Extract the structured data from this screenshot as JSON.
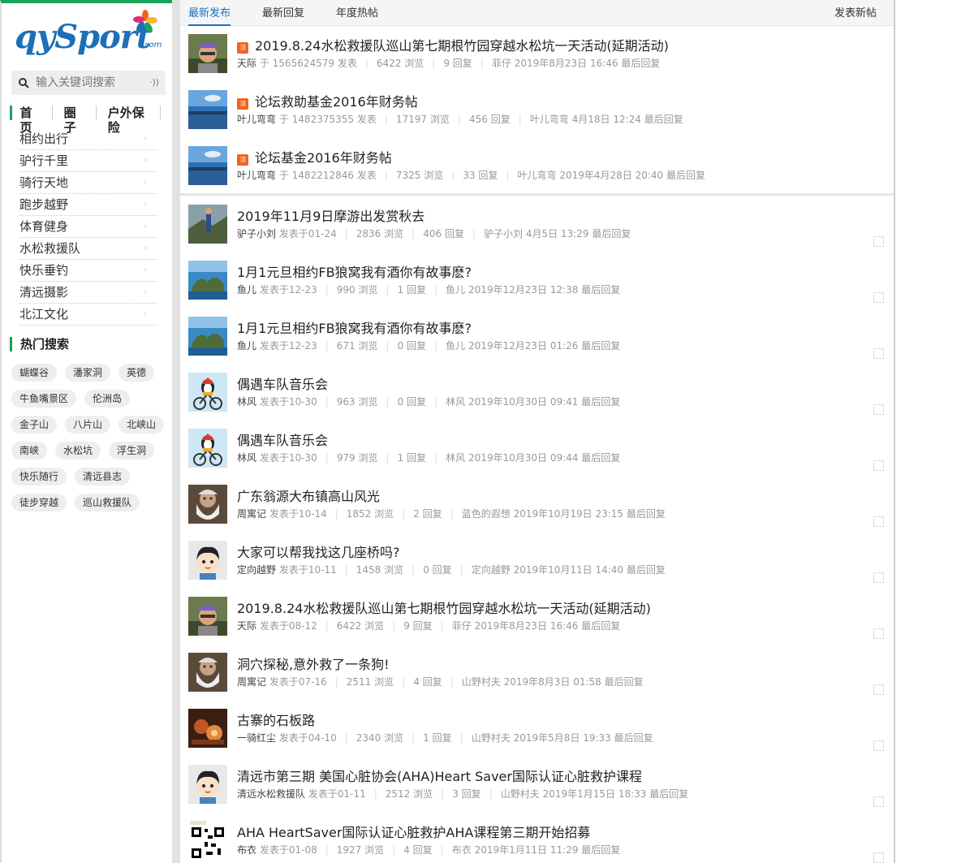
{
  "logo": {
    "text": "qySport",
    "suffix": "com"
  },
  "search": {
    "placeholder": "输入关键词搜索"
  },
  "nav_top": [
    "首页",
    "圈子",
    "户外保险"
  ],
  "forums": [
    "相约出行",
    "驴行千里",
    "骑行天地",
    "跑步越野",
    "体育健身",
    "水松救援队",
    "快乐垂钓",
    "清远摄影",
    "北江文化"
  ],
  "hot_title": "热门搜索",
  "tags": [
    [
      "蝴蝶谷",
      "潘家洞",
      "英德"
    ],
    [
      "牛鱼嘴景区",
      "伦洲岛"
    ],
    [
      "金子山",
      "八片山",
      "北峡山"
    ],
    [
      "南峡",
      "水松坑",
      "浮生洞"
    ],
    [
      "快乐随行",
      "清远县志"
    ],
    [
      "徒步穿越",
      "巡山救援队"
    ]
  ],
  "tabs": {
    "t1": "最新发布",
    "t2": "最新回复",
    "t3": "年度热帖",
    "new_post": "发表新帖"
  },
  "colors": {
    "accent_green": "#1aa35b",
    "accent_blue": "#1a6fc0",
    "badge_orange": "#f2641e"
  },
  "pinned": [
    {
      "title": "2019.8.24水松救援队巡山第七期根竹园穿越水松坑一天活动(延期活动)",
      "author": "天际",
      "posted": "于  1565624579  发表",
      "views": "6422",
      "replies": "9",
      "last_user": "菲仔",
      "last_time": "2019年8月23日  16:46",
      "avatar": "hat"
    },
    {
      "title": "论坛救助基金2016年财务帖",
      "author": "叶儿弯弯",
      "posted": "于  1482375355  发表",
      "views": "17197",
      "replies": "456",
      "last_user": "叶儿弯弯",
      "last_time": "4月18日  12:24",
      "avatar": "lake"
    },
    {
      "title": "论坛基金2016年财务帖",
      "author": "叶儿弯弯",
      "posted": "于  1482212846  发表",
      "views": "7325",
      "replies": "33",
      "last_user": "叶儿弯弯",
      "last_time": "2019年4月28日  20:40",
      "avatar": "lake"
    }
  ],
  "threads": [
    {
      "title": "2019年11月9日摩游出发赏秋去",
      "author": "驴子小刘",
      "posted": "发表于01-24",
      "views": "2836",
      "replies": "406",
      "last_user": "驴子小刘",
      "last_time": "4月5日  13:29",
      "avatar": "hiker"
    },
    {
      "title": "1月1元旦相约FB狼窝我有酒你有故事麽?",
      "author": "鱼儿",
      "posted": "发表于12-23",
      "views": "990",
      "replies": "1",
      "last_user": "鱼儿",
      "last_time": "2019年12月23日  12:38",
      "avatar": "island"
    },
    {
      "title": "1月1元旦相约FB狼窝我有酒你有故事麽?",
      "author": "鱼儿",
      "posted": "发表于12-23",
      "views": "671",
      "replies": "0",
      "last_user": "鱼儿",
      "last_time": "2019年12月23日  01:26",
      "avatar": "island"
    },
    {
      "title": "偶遇车队音乐会",
      "author": "林风",
      "posted": "发表于10-30",
      "views": "963",
      "replies": "0",
      "last_user": "林风",
      "last_time": "2019年10月30日  09:41",
      "avatar": "cyclist"
    },
    {
      "title": "偶遇车队音乐会",
      "author": "林风",
      "posted": "发表于10-30",
      "views": "979",
      "replies": "1",
      "last_user": "林风",
      "last_time": "2019年10月30日  09:44",
      "avatar": "cyclist"
    },
    {
      "title": "广东翁源大布镇高山风光",
      "author": "周寓记",
      "posted": "发表于10-14",
      "views": "1852",
      "replies": "2",
      "last_user": "蓝色的遐想",
      "last_time": "2019年10月19日  23:15",
      "avatar": "oldman"
    },
    {
      "title": "大家可以帮我找这几座桥吗?",
      "author": "定向越野",
      "posted": "发表于10-11",
      "views": "1458",
      "replies": "0",
      "last_user": "定向越野",
      "last_time": "2019年10月11日  14:40",
      "avatar": "cartoon"
    },
    {
      "title": "2019.8.24水松救援队巡山第七期根竹园穿越水松坑一天活动(延期活动)",
      "author": "天际",
      "posted": "发表于08-12",
      "views": "6422",
      "replies": "9",
      "last_user": "菲仔",
      "last_time": "2019年8月23日  16:46",
      "avatar": "hat"
    },
    {
      "title": "洞穴探秘,意外救了一条狗!",
      "author": "周寓记",
      "posted": "发表于07-16",
      "views": "2511",
      "replies": "4",
      "last_user": "山野村夫",
      "last_time": "2019年8月3日  01:58",
      "avatar": "oldman"
    },
    {
      "title": "古寨的石板路",
      "author": "一骑红尘",
      "posted": "发表于04-10",
      "views": "2340",
      "replies": "1",
      "last_user": "山野村夫",
      "last_time": "2019年5月8日  19:33",
      "avatar": "food"
    },
    {
      "title": "清远市第三期 美国心脏协会(AHA)Heart Saver国际认证心脏救护课程",
      "author": "清远水松救援队",
      "posted": "发表于01-11",
      "views": "2512",
      "replies": "3",
      "last_user": "山野村夫",
      "last_time": "2019年1月15日  18:33",
      "avatar": "cartoon"
    },
    {
      "title": "AHA HeartSaver国际认证心脏救护AHA课程第三期开始招募",
      "author": "布衣",
      "posted": "发表于01-08",
      "views": "1927",
      "replies": "4",
      "last_user": "布衣",
      "last_time": "2019年1月11日  11:29",
      "avatar": "qr"
    }
  ],
  "labels": {
    "views": "浏览",
    "replies": "回复",
    "last_reply": "最后回复",
    "badge": "顶"
  }
}
